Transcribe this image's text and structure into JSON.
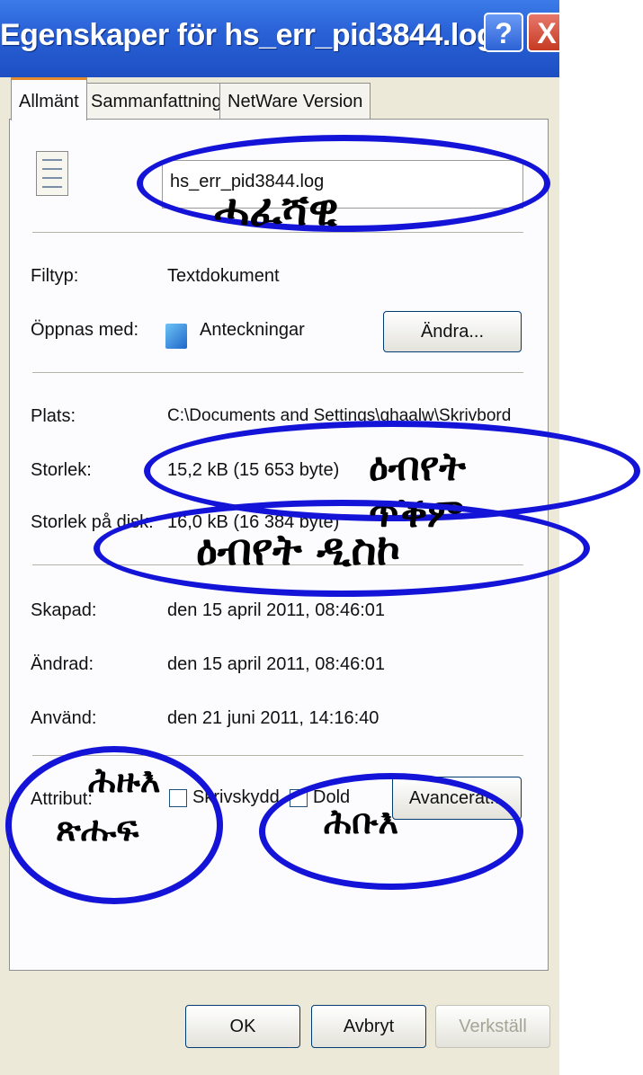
{
  "window": {
    "title": "Egenskaper för hs_err_pid3844.log",
    "help_glyph": "?",
    "close_glyph": "X"
  },
  "tabs": [
    "Allmänt",
    "Sammanfattning",
    "NetWare Version"
  ],
  "general": {
    "file_name": "hs_err_pid3844.log",
    "file_type_label": "Filtyp:",
    "file_type_value": "Textdokument",
    "opens_with_label": "Öppnas med:",
    "opens_with_value": "Anteckningar",
    "change_button": "Ändra...",
    "location_label": "Plats:",
    "location_value": "C:\\Documents and Settings\\ghaalw\\Skrivbord",
    "size_label": "Storlek:",
    "size_value": "15,2 kB (15 653 byte)",
    "size_on_disk_label": "Storlek på disk:",
    "size_on_disk_value": "16,0 kB (16 384 byte)",
    "created_label": "Skapad:",
    "created_value": "den 15 april 2011, 08:46:01",
    "modified_label": "Ändrad:",
    "modified_value": "den 15 april 2011, 08:46:01",
    "accessed_label": "Använd:",
    "accessed_value": "den 21 juni 2011, 14:16:40",
    "attributes_label": "Attribut:",
    "readonly_label": "Skrivskydd",
    "hidden_label": "Dold",
    "advanced_button": "Avancerat..."
  },
  "footer": {
    "ok": "OK",
    "cancel": "Avbryt",
    "apply": "Verkställ"
  },
  "annotations": {
    "name": "ሓፈሻዊ",
    "size": "ዕብየት ጥቕም",
    "size_on_disk": "ዕብየት ዲስኮ",
    "attributes_line1": "ሕዙእ",
    "attributes_line2": "ጽሑፍ",
    "hidden": "ሕቡእ"
  },
  "colors": {
    "annotation_oval": "#1414d8",
    "titlebar": "#2a62d8",
    "dialog_bg": "#ece9d8"
  }
}
